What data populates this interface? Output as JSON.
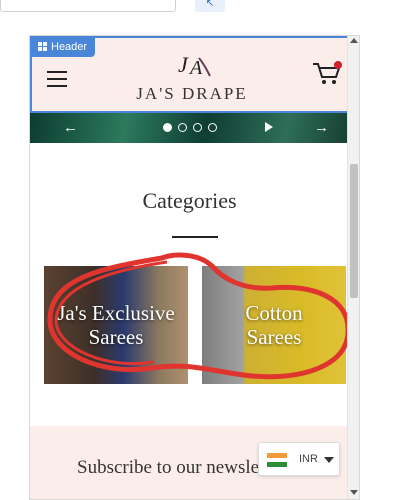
{
  "editor": {
    "header_tag": "Header",
    "tool_icon": "cursor-select-icon"
  },
  "header": {
    "brand": "JA'S DRAPE",
    "logo": "JA",
    "menu_icon": "hamburger-icon",
    "cart_icon": "cart-icon"
  },
  "slider": {
    "dot_count": 4,
    "active_dot": 1
  },
  "categories": {
    "title": "Categories",
    "items": [
      {
        "label": "Ja's Exclusive Sarees"
      },
      {
        "label": "Cotton Sarees"
      }
    ]
  },
  "subscribe": {
    "title": "Subscribe to our newsletter"
  },
  "currency": {
    "code": "INR",
    "flag_icon": "india-flag-icon"
  },
  "colors": {
    "header_bg": "#fbeeea",
    "selection_blue": "#4a86d8",
    "annotation_red": "#e0342f"
  }
}
